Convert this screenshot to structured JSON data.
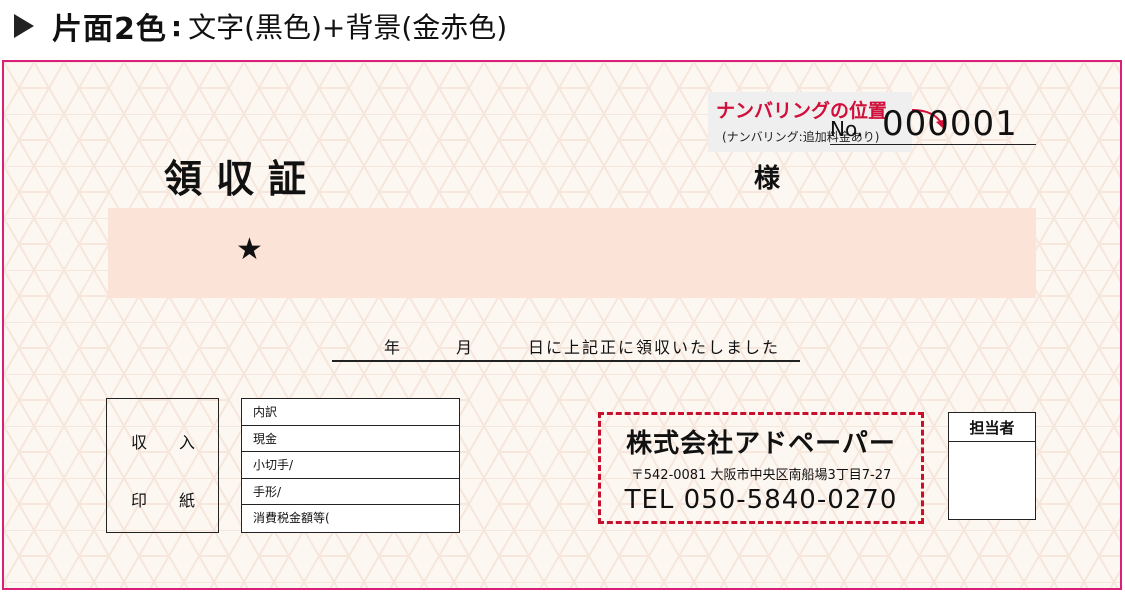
{
  "header": {
    "title_main": "片面2色",
    "title_colon": ":",
    "title_detail": "文字(黒色)+背景(金赤色)"
  },
  "numbering_callout": {
    "title": "ナンバリングの位置",
    "note": "(ナンバリング:追加料金あり)",
    "accent_color": "#d0103a"
  },
  "receipt": {
    "no_label": "No.",
    "no_value": "000001",
    "title": "領収証",
    "honorific": "様",
    "amount_mark": "★",
    "date_line": "年　　　月　　　日に上記正に領収いたしました",
    "stamp_box": {
      "line1": "収　　入",
      "line2": "印　　紙"
    },
    "breakdown_rows": [
      "内訳",
      "現金",
      "小切手/",
      "手形/",
      "消費税金額等("
    ],
    "company": {
      "name": "株式会社アドペーパー",
      "address": "〒542-0081 大阪市中央区南船場3丁目7-27",
      "tel": "TEL 050-5840-0270",
      "border_color": "#c8102e"
    },
    "staff_label": "担当者",
    "frame_color": "#d8207a",
    "band_color": "#fce3d8"
  }
}
